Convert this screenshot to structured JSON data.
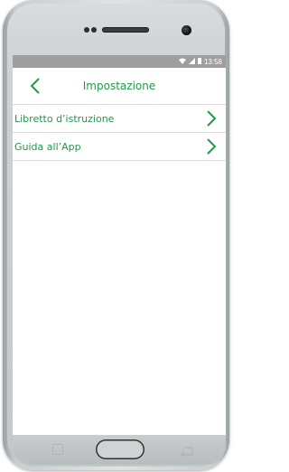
{
  "status_bar": {
    "time": "13:58",
    "wifi_icon": "wifi-icon",
    "signal_icon": "signal-icon",
    "battery_icon": "battery-icon"
  },
  "app_bar": {
    "title": "Impostazione",
    "back_icon": "chevron-left-icon"
  },
  "menu": {
    "items": [
      {
        "label": "Libretto d’istruzione",
        "icon": "chevron-right-icon"
      },
      {
        "label": "Guida all’App",
        "icon": "chevron-right-icon"
      }
    ]
  },
  "colors": {
    "accent": "#1f9a4a",
    "status_bar_bg": "#9e9e9e",
    "divider": "#dcdcdc"
  }
}
